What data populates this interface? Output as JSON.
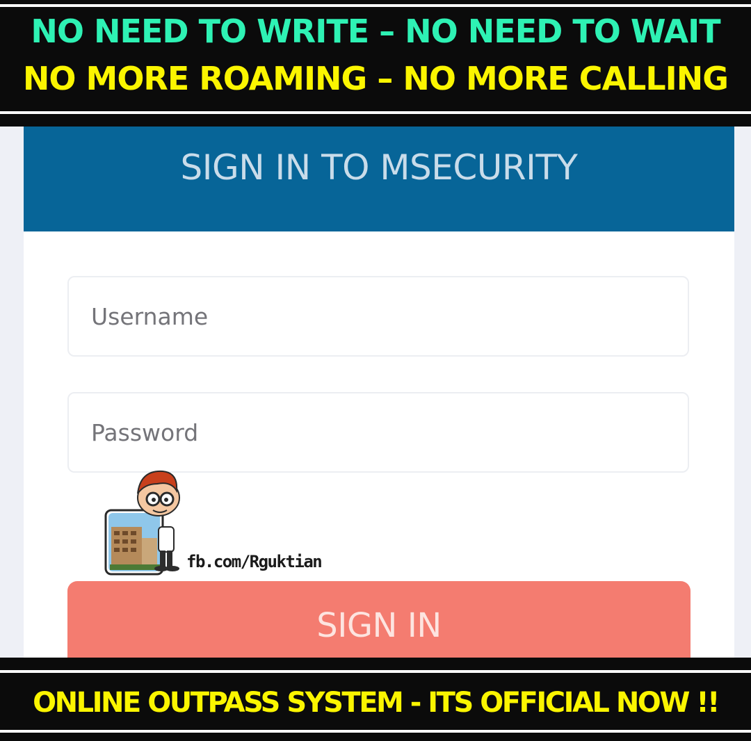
{
  "banner_top": {
    "line1": "NO NEED TO WRITE – NO NEED TO WAIT",
    "line2": "NO MORE ROAMING – NO MORE CALLING",
    "line1_color": "#2ef2b4",
    "line2_color": "#fbf500"
  },
  "login": {
    "title": "SIGN IN TO MSECURITY",
    "username_placeholder": "Username",
    "password_placeholder": "Password",
    "signin_label": "SIGN IN",
    "header_color": "#076598",
    "button_color": "#f47c70"
  },
  "watermark": {
    "text": "fb.com/Rguktian",
    "icon": "cartoon-boy-with-building-icon"
  },
  "banner_bottom": {
    "text": "ONLINE OUTPASS SYSTEM - ITS OFFICIAL NOW !!"
  }
}
